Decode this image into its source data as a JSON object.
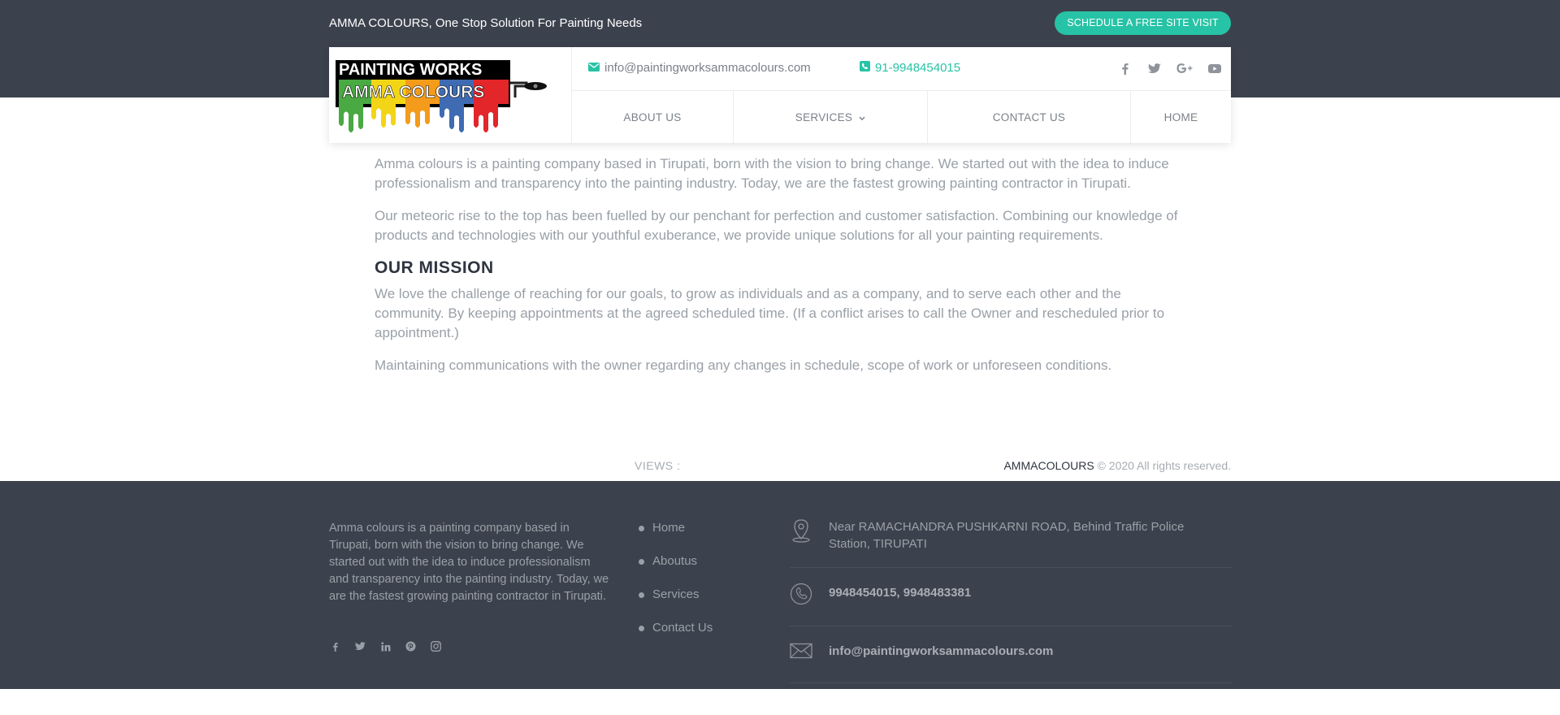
{
  "topbar": {
    "tagline": "AMMA COLOURS, One Stop Solution For Painting Needs",
    "cta_label": "SCHEDULE A FREE SITE VISIT",
    "accent_color": "#27c3a6",
    "bg_color": "#3c424d"
  },
  "header": {
    "logo": {
      "line1": "PAINTING WORKS",
      "line2": "AMMA COLOURS"
    },
    "email": "info@paintingworksammacolours.com",
    "phone": "91-9948454015",
    "socials": [
      "facebook-icon",
      "twitter-icon",
      "google-plus-icon",
      "youtube-icon"
    ]
  },
  "nav": {
    "items": [
      {
        "label": "ABOUT US"
      },
      {
        "label": "SERVICES"
      },
      {
        "label": "CONTACT US"
      },
      {
        "label": "HOME"
      }
    ]
  },
  "content": {
    "para1": "Amma colours is a painting company based in Tirupati, born with the vision to bring change. We started out with the idea to induce professionalism and transparency into the painting industry. Today, we are the fastest growing painting contractor in Tirupati.",
    "para2": "Our meteoric rise to the top has been fuelled by our penchant for perfection and customer satisfaction. Combining our knowledge of products and technologies with our youthful exuberance, we provide unique solutions for all your painting requirements.",
    "mission_title": "OUR MISSION",
    "mission_para1": "We love the challenge of reaching for our goals, to grow as individuals and as a company, and to serve each other and the community. By keeping appointments at the agreed scheduled time. (If a conflict arises to call the Owner and rescheduled prior to appointment.)",
    "mission_para2": "Maintaining communications with the owner regarding any changes in schedule, scope of work or unforeseen conditions."
  },
  "bottom_bar": {
    "views_label": "VIEWS :",
    "brand": "AMMACOLOURS",
    "copyright": "© 2020 All rights reserved."
  },
  "footer": {
    "about": "Amma colours is a painting company based in Tirupati, born with the vision to bring change. We started out with the idea to induce professionalism and transparency into the painting industry. Today, we are the fastest growing painting contractor in Tirupati.",
    "socials": [
      "facebook-icon",
      "twitter-icon",
      "linkedin-icon",
      "pinterest-icon",
      "instagram-icon"
    ],
    "links": [
      {
        "label": "Home"
      },
      {
        "label": "Aboutus"
      },
      {
        "label": "Services"
      },
      {
        "label": "Contact Us"
      }
    ],
    "address": "Near RAMACHANDRA PUSHKARNI ROAD, Behind Traffic Police Station, TIRUPATI",
    "phones": "9948454015, 9948483381",
    "email": "info@paintingworksammacolours.com"
  }
}
